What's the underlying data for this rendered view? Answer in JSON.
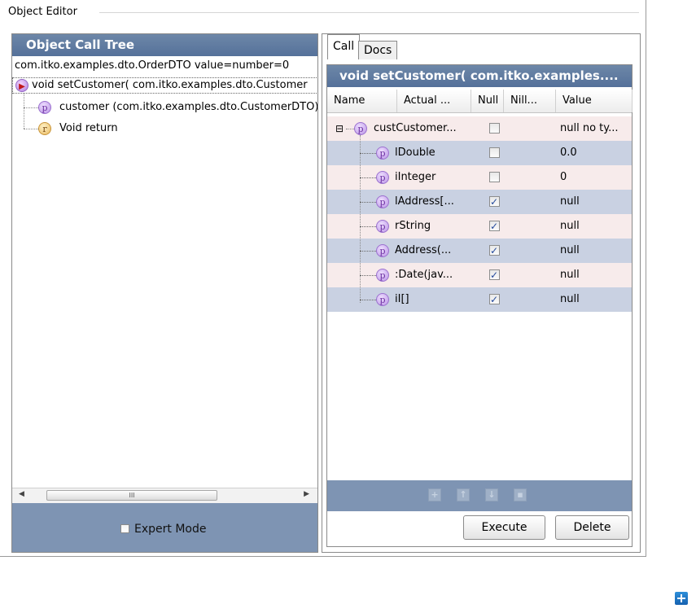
{
  "window": {
    "title": "Object Editor"
  },
  "left_panel": {
    "title": "Object Call Tree",
    "tree": [
      {
        "label": "com.itko.examples.dto.OrderDTO value=number=0",
        "icon": "none"
      },
      {
        "label": "void setCustomer( com.itko.examples.dto.Customer",
        "icon": "method-icon"
      },
      {
        "label": "customer (com.itko.examples.dto.CustomerDTO)",
        "icon": "parameter-icon",
        "glyph": "p"
      },
      {
        "label": "Void return",
        "icon": "return-icon",
        "glyph": "r"
      }
    ],
    "scroll_thumb_label": "III",
    "expert_mode_label": "Expert Mode",
    "expert_mode_checked": false
  },
  "right_panel": {
    "tabs": [
      "Call",
      "Docs"
    ],
    "active_tab": "Call",
    "header": "void setCustomer( com.itko.examples....",
    "columns": [
      "Name",
      "Actual ...",
      "Null",
      "Nill...",
      "Value"
    ],
    "rows": [
      {
        "name": "custCustomer...",
        "expander": "⊟",
        "null": false,
        "value": "null no ty..."
      },
      {
        "name": "lDouble",
        "null": false,
        "value": "0.0"
      },
      {
        "name": "iInteger",
        "null": false,
        "value": "0"
      },
      {
        "name": "lAddress[...",
        "null": true,
        "value": "null"
      },
      {
        "name": "rString",
        "null": true,
        "value": "null"
      },
      {
        "name": "​Address(...",
        "null": true,
        "value": "null"
      },
      {
        "name": ":Date(jav...",
        "null": true,
        "value": "null"
      },
      {
        "name": "iI[]",
        "null": true,
        "value": "null"
      }
    ],
    "toolbar_icons": [
      "add-icon",
      "move-up-icon",
      "move-down-icon",
      "delete-icon"
    ],
    "buttons": {
      "execute": "Execute",
      "delete": "Delete"
    }
  },
  "colors": {
    "panel_header": "#5f7ba1",
    "footer": "#7e94b3",
    "row_even": "#f7ebeb",
    "row_odd": "#c9d1e2"
  }
}
